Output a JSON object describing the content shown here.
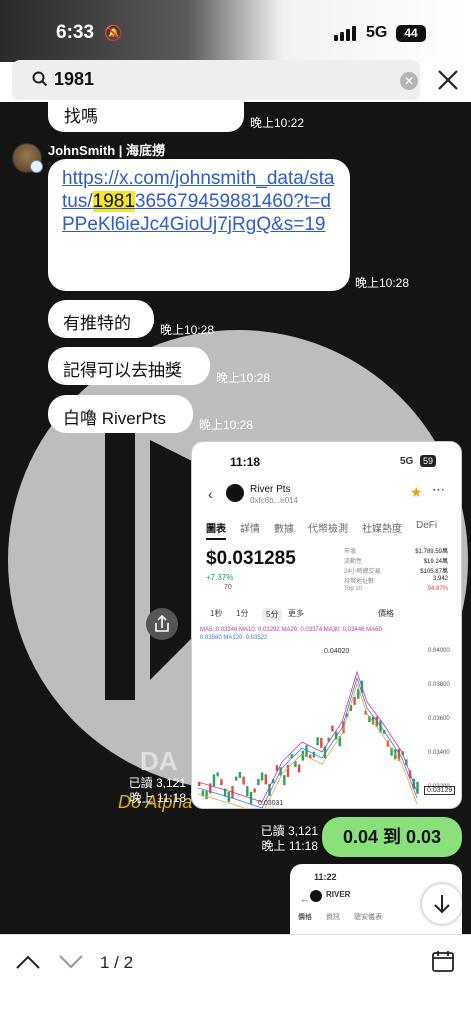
{
  "status": {
    "time": "6:33",
    "network": "5G",
    "battery": "44"
  },
  "search": {
    "query": "1981"
  },
  "messages": {
    "prev_text": "找嗎",
    "prev_time": "晚上10:22",
    "sender": "JohnSmith | 海底撈",
    "link_pre": "https://x.com/johnsmith_data/status/",
    "link_hl": "1981",
    "link_post": "365679459881460?t=dPPeKl6ieJc4GioUj7jRgQ&s=19",
    "link_time": "晚上10:28",
    "m1": "有推特的",
    "m1_time": "晚上10:28",
    "m2": "記得可以去抽獎",
    "m2_time": "晚上10:28",
    "m3": "白嚕 RiverPts",
    "m3_time": "晚上10:28",
    "shot_read": "已讀 3,121",
    "shot_time": "晚上 11:18",
    "green_text": "0.04 到 0.03",
    "green_read": "已讀 3,121",
    "green_time": "晚上 11:18"
  },
  "screenshot": {
    "time": "11:18",
    "network": "5G",
    "battery": "59",
    "token": "River Pts",
    "address": "0xfc6b...e014",
    "tabs": [
      "圖表",
      "詳情",
      "數據",
      "代幣檢測",
      "社媒熱度",
      "DeFi"
    ],
    "price": "$0.031285",
    "change": "+7.37%",
    "score": "70",
    "stats": [
      [
        "市值",
        "$1,789.59萬"
      ],
      [
        "流動性",
        "$19.24萬"
      ],
      [
        "24小時總交易",
        "$105.87萬"
      ],
      [
        "持幣地址數",
        "3,942"
      ],
      [
        "Top 10",
        "94.87%"
      ]
    ],
    "intervals": [
      "1秒",
      "1分",
      "5分",
      "更多"
    ],
    "price_label": "價格",
    "ma_line1": "MA5: 0.03246  MA10: 0.03292  MA20: 0.03374  MA30: 0.03446  MA60",
    "ma_line2": "0.03560  MA120: 0.03522",
    "high_label": "0.04020",
    "low_label": "0.03031",
    "last_label": "0.03129",
    "yticks": [
      "0.04000",
      "0.03800",
      "0.03600",
      "0.03400",
      "0.03200",
      "0.03000"
    ]
  },
  "screenshot2": {
    "time": "11:22",
    "token": "RIVER",
    "tabs": [
      "價格",
      "資訊",
      "聰安儀表"
    ]
  },
  "bottom": {
    "counter": "1 / 2"
  },
  "colors": {
    "accent_green": "#8ae07b",
    "link": "#2d5bd1",
    "highlight": "#f5e62a"
  }
}
